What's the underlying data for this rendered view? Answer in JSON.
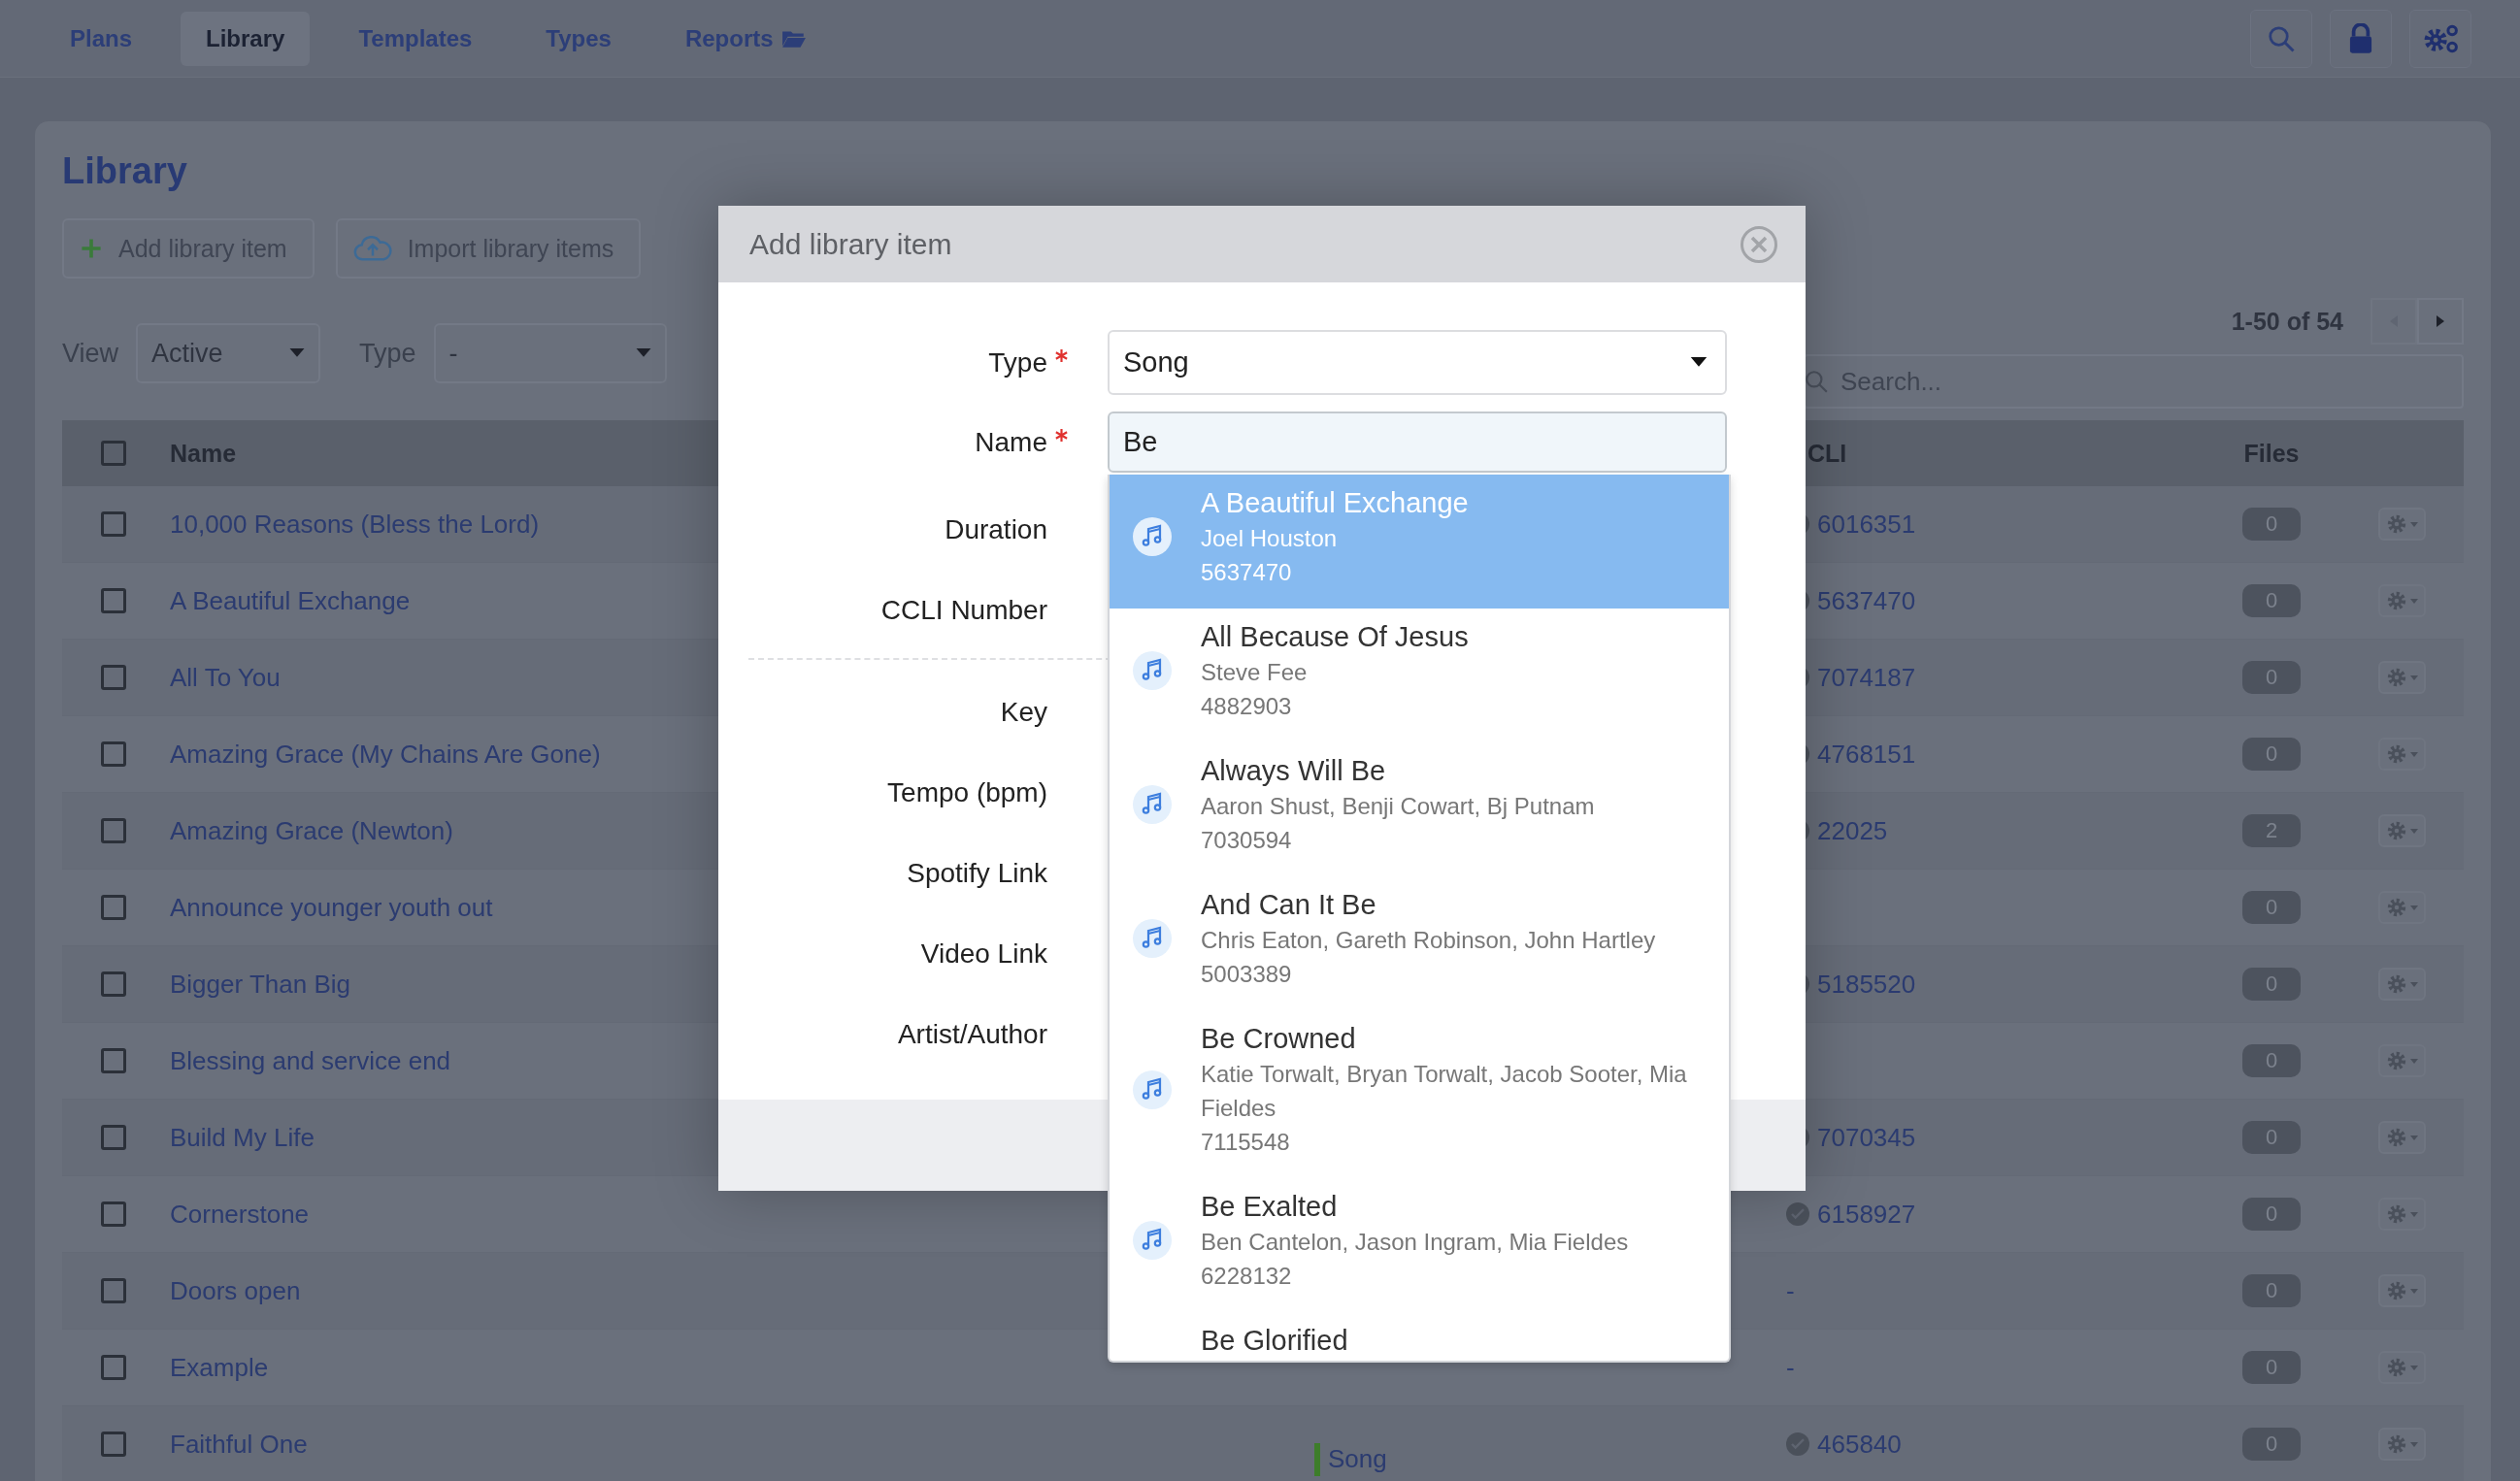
{
  "nav": {
    "tabs": [
      {
        "label": "Plans",
        "selected": false
      },
      {
        "label": "Library",
        "selected": true
      },
      {
        "label": "Templates",
        "selected": false
      },
      {
        "label": "Types",
        "selected": false
      },
      {
        "label": "Reports",
        "selected": false
      }
    ]
  },
  "library": {
    "title": "Library",
    "buttons": [
      {
        "label": "Add library item"
      },
      {
        "label": "Import library items"
      }
    ],
    "filters": [
      {
        "label": "View",
        "value": "Active"
      },
      {
        "label": "Type",
        "value": "-"
      }
    ],
    "pager": {
      "text": "1-50 of 54"
    },
    "search": {
      "placeholder": "Search..."
    },
    "table": {
      "columns": [
        "Name",
        "CLI",
        "Files"
      ],
      "all_checked": false,
      "rows": [
        {
          "checked": false,
          "name": "10,000 Reasons (Bless the Lord)",
          "verified": true,
          "ccli": "6016351",
          "files": "0"
        },
        {
          "checked": false,
          "name": "A Beautiful Exchange",
          "verified": true,
          "ccli": "5637470",
          "files": "0"
        },
        {
          "checked": false,
          "name": "All To You",
          "verified": true,
          "ccli": "7074187",
          "files": "0"
        },
        {
          "checked": false,
          "name": "Amazing Grace (My Chains Are Gone)",
          "verified": true,
          "ccli": "4768151",
          "files": "0"
        },
        {
          "checked": false,
          "name": "Amazing Grace (Newton)",
          "verified": true,
          "ccli": "22025",
          "files": "2"
        },
        {
          "checked": false,
          "name": "Announce younger youth out",
          "verified": false,
          "files": "0"
        },
        {
          "checked": false,
          "name": "Bigger Than Big",
          "verified": true,
          "ccli": "5185520",
          "files": "0"
        },
        {
          "checked": false,
          "name": "Blessing and service end",
          "verified": false,
          "files": "0"
        },
        {
          "checked": false,
          "name": "Build My Life",
          "verified": true,
          "ccli": "7070345",
          "files": "0"
        },
        {
          "checked": false,
          "name": "Cornerstone",
          "verified": true,
          "ccli": "6158927",
          "files": "0"
        },
        {
          "checked": false,
          "name": "Doors open",
          "verified": false,
          "ccli": "-",
          "files": "0"
        },
        {
          "checked": false,
          "name": "Example",
          "verified": false,
          "ccli": "-",
          "files": "0"
        },
        {
          "checked": false,
          "name": "Faithful One",
          "type": "Song",
          "verified": true,
          "ccli": "465840",
          "files": "0"
        }
      ]
    }
  },
  "modal": {
    "title": "Add library item",
    "sections": [
      [
        {
          "label": "Type",
          "required": true,
          "kind": "select",
          "value": "Song"
        },
        {
          "label": "Name",
          "required": true,
          "kind": "text",
          "value": "Be"
        },
        {
          "label": "Duration",
          "required": false,
          "kind": "covered"
        },
        {
          "label": "CCLI Number",
          "required": false,
          "kind": "covered"
        }
      ],
      [
        {
          "label": "Key",
          "required": false,
          "kind": "covered"
        },
        {
          "label": "Tempo (bpm)",
          "required": false,
          "kind": "covered"
        },
        {
          "label": "Spotify Link",
          "required": false,
          "kind": "covered"
        },
        {
          "label": "Video Link",
          "required": false,
          "kind": "covered"
        },
        {
          "label": "Artist/Author",
          "required": false,
          "kind": "covered"
        }
      ]
    ],
    "suggestions": [
      {
        "title": "A Beautiful Exchange",
        "authors": "Joel Houston",
        "ccli": "5637470",
        "selected": true
      },
      {
        "title": "All Because Of Jesus",
        "authors": "Steve Fee",
        "ccli": "4882903",
        "selected": false
      },
      {
        "title": "Always Will Be",
        "authors": "Aaron Shust, Benji Cowart, Bj Putnam",
        "ccli": "7030594",
        "selected": false
      },
      {
        "title": "And Can It Be",
        "authors": "Chris Eaton, Gareth Robinson, John Hartley",
        "ccli": "5003389",
        "selected": false
      },
      {
        "title": "Be Crowned",
        "authors": "Katie Torwalt, Bryan Torwalt, Jacob Sooter, Mia Fieldes",
        "ccli": "7115548",
        "selected": false
      },
      {
        "title": "Be Exalted",
        "authors": "Ben Cantelon, Jason Ingram, Mia Fieldes",
        "ccli": "6228132",
        "selected": false
      },
      {
        "title": "Be Glorified",
        "selected": false
      }
    ]
  }
}
